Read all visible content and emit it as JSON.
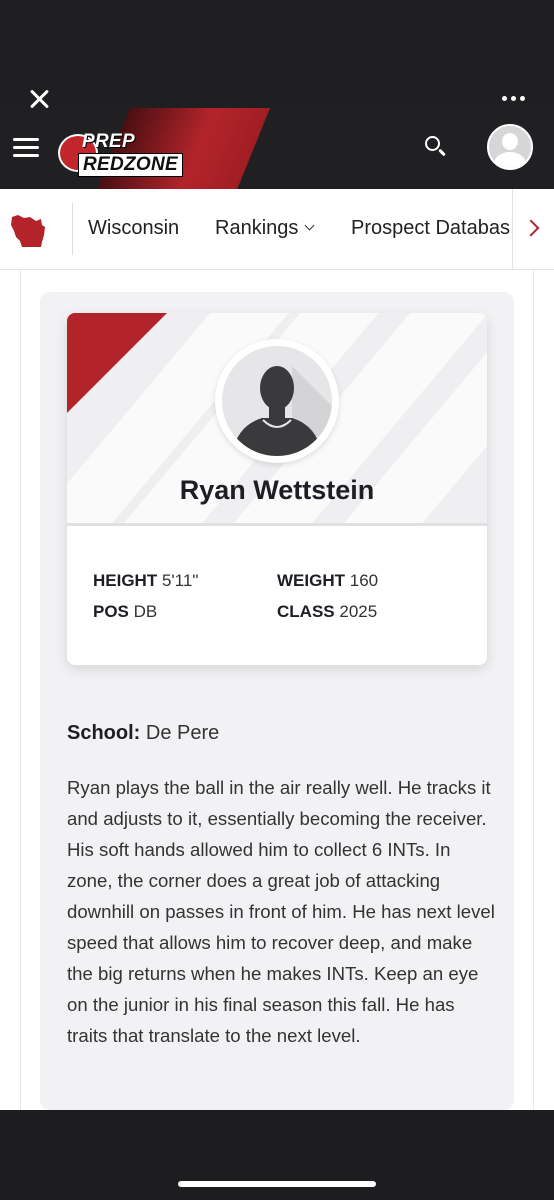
{
  "header": {
    "logo_line1": "PREP",
    "logo_line2": "REDZONE"
  },
  "nav": {
    "items": [
      "Wisconsin",
      "Rankings",
      "Prospect Databas"
    ]
  },
  "player": {
    "name": "Ryan Wettstein",
    "stats": {
      "height_label": "HEIGHT",
      "height_value": "5'11\"",
      "weight_label": "WEIGHT",
      "weight_value": "160",
      "pos_label": "POS",
      "pos_value": "DB",
      "class_label": "CLASS",
      "class_value": "2025"
    },
    "school_label": "School:",
    "school_value": "De Pere",
    "bio": "Ryan plays the ball in the air really well. He tracks it and adjusts to it, essentially becoming the receiver. His soft hands allowed him to collect 6 INTs. In zone, the corner does a great job of attacking downhill on passes in front of him. He has next level speed that allows him to recover deep, and make the big returns when he makes INTs. Keep an eye on the junior in his final season this fall. He has traits that translate to the next level."
  },
  "colors": {
    "brand_red": "#b3242a",
    "header_dark": "#202023"
  },
  "icons": [
    "close-icon",
    "more-icon",
    "menu-icon",
    "search-icon",
    "user-avatar-icon",
    "wisconsin-state-icon",
    "chevron-down-icon",
    "chevron-right-icon",
    "player-silhouette-icon"
  ]
}
